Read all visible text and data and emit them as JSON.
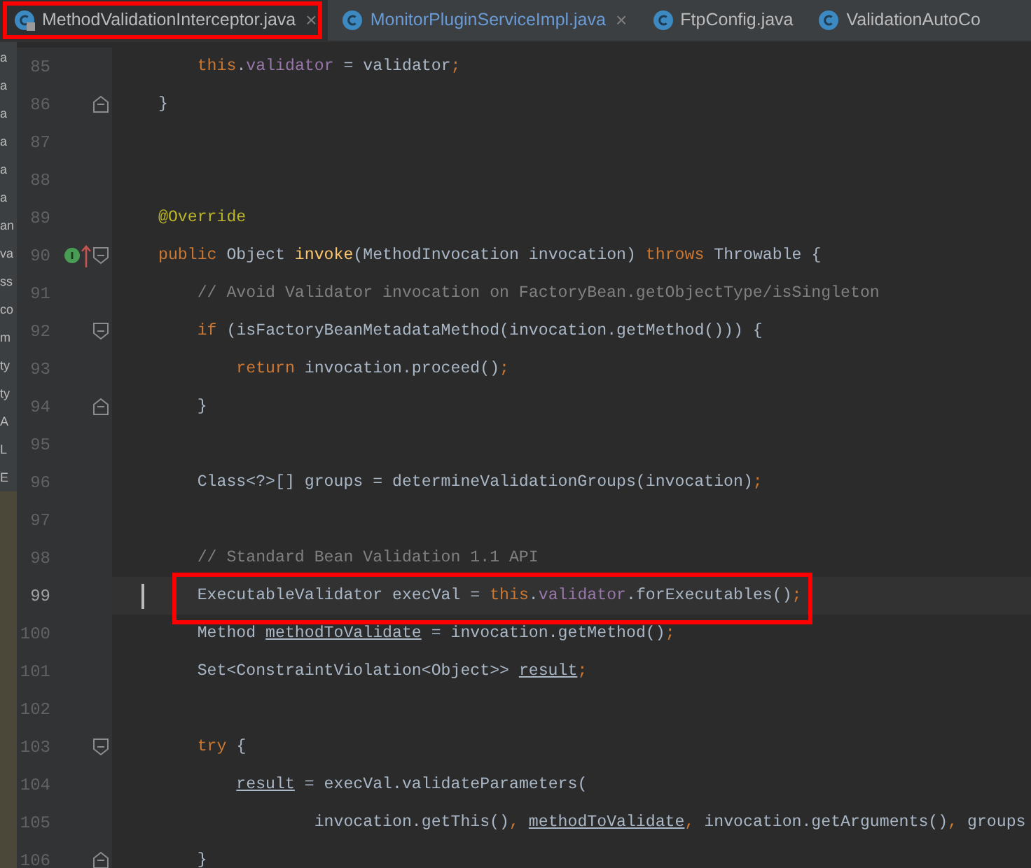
{
  "tabs": [
    {
      "label": "MethodValidationInterceptor.java",
      "selected": true,
      "modified": false,
      "locked": true,
      "close": "×",
      "highlighted": true
    },
    {
      "label": "MonitorPluginServiceImpl.java",
      "selected": false,
      "modified": true,
      "locked": false,
      "close": "×",
      "highlighted": false
    },
    {
      "label": "FtpConfig.java",
      "selected": false,
      "modified": false,
      "locked": false,
      "highlighted": false
    },
    {
      "label": "ValidationAutoCo",
      "selected": false,
      "modified": false,
      "locked": false,
      "highlighted": false
    }
  ],
  "sidebar_fragments": [
    "a",
    "a",
    "a",
    "a",
    "a",
    "a",
    "an",
    "va",
    "ss",
    "co",
    "m",
    "ty",
    "ty",
    "A",
    "L",
    "E"
  ],
  "lines": [
    {
      "number": "85",
      "tokens": [
        {
          "text": "    this",
          "kind": "kw"
        },
        {
          "text": ".",
          "kind": "plain"
        },
        {
          "text": "validator",
          "kind": "field"
        },
        {
          "text": " = validator",
          "kind": "plain"
        },
        {
          "text": ";",
          "kind": "punct"
        }
      ]
    },
    {
      "number": "86",
      "fold_end": true,
      "tokens": [
        {
          "text": "}",
          "kind": "plain"
        }
      ]
    },
    {
      "number": "87"
    },
    {
      "number": "88"
    },
    {
      "number": "89",
      "tokens": [
        {
          "text": "@Override",
          "kind": "annotation"
        }
      ]
    },
    {
      "number": "90",
      "fold_start": true,
      "overrides": true,
      "tokens": [
        {
          "text": "public",
          "kind": "kw"
        },
        {
          "text": " Object ",
          "kind": "plain"
        },
        {
          "text": "invoke",
          "kind": "decl"
        },
        {
          "text": "(MethodInvocation invocation) ",
          "kind": "plain"
        },
        {
          "text": "throws",
          "kind": "kw"
        },
        {
          "text": " Throwable {",
          "kind": "plain"
        }
      ]
    },
    {
      "number": "91",
      "tokens": [
        {
          "text": "    // Avoid Validator invocation on FactoryBean.getObjectType/isSingleton",
          "kind": "comment"
        }
      ]
    },
    {
      "number": "92",
      "fold_start": true,
      "tokens": [
        {
          "text": "    if",
          "kind": "kw"
        },
        {
          "text": " (isFactoryBeanMetadataMethod(invocation.getMethod())) {",
          "kind": "plain"
        }
      ]
    },
    {
      "number": "93",
      "tokens": [
        {
          "text": "        return",
          "kind": "kw"
        },
        {
          "text": " invocation.proceed()",
          "kind": "plain"
        },
        {
          "text": ";",
          "kind": "punct"
        }
      ]
    },
    {
      "number": "94",
      "fold_end": true,
      "tokens": [
        {
          "text": "    }",
          "kind": "plain"
        }
      ]
    },
    {
      "number": "95"
    },
    {
      "number": "96",
      "tokens": [
        {
          "text": "    Class<?>[] groups = determineValidationGroups(invocation)",
          "kind": "plain"
        },
        {
          "text": ";",
          "kind": "punct"
        }
      ]
    },
    {
      "number": "97"
    },
    {
      "number": "98",
      "tokens": [
        {
          "text": "    // Standard Bean Validation 1.1 API",
          "kind": "comment"
        }
      ]
    },
    {
      "number": "99",
      "current": true,
      "highlighted": true,
      "tokens": [
        {
          "text": "    ExecutableValidator execVal = ",
          "kind": "plain"
        },
        {
          "text": "this",
          "kind": "kw"
        },
        {
          "text": ".",
          "kind": "plain"
        },
        {
          "text": "validator",
          "kind": "field"
        },
        {
          "text": ".forExecutables()",
          "kind": "plain"
        },
        {
          "text": ";",
          "kind": "punct"
        }
      ]
    },
    {
      "number": "100",
      "tokens": [
        {
          "text": "    Method ",
          "kind": "plain"
        },
        {
          "text": "methodToValidate",
          "kind": "underline"
        },
        {
          "text": " = invocation.getMethod()",
          "kind": "plain"
        },
        {
          "text": ";",
          "kind": "punct"
        }
      ]
    },
    {
      "number": "101",
      "tokens": [
        {
          "text": "    Set<ConstraintViolation<Object>> ",
          "kind": "plain"
        },
        {
          "text": "result",
          "kind": "underline"
        },
        {
          "text": ";",
          "kind": "punct"
        }
      ]
    },
    {
      "number": "102"
    },
    {
      "number": "103",
      "fold_start": true,
      "tokens": [
        {
          "text": "    try",
          "kind": "kw"
        },
        {
          "text": " {",
          "kind": "plain"
        }
      ]
    },
    {
      "number": "104",
      "tokens": [
        {
          "text": "        result",
          "kind": "underline"
        },
        {
          "text": " = execVal.validateParameters(",
          "kind": "plain"
        }
      ]
    },
    {
      "number": "105",
      "tokens": [
        {
          "text": "                invocation.getThis()",
          "kind": "plain"
        },
        {
          "text": ", ",
          "kind": "punct"
        },
        {
          "text": "methodToValidate",
          "kind": "underline"
        },
        {
          "text": ", ",
          "kind": "punct"
        },
        {
          "text": "invocation.getArguments()",
          "kind": "plain"
        },
        {
          "text": ", ",
          "kind": "punct"
        },
        {
          "text": "groups",
          "kind": "plain"
        }
      ]
    },
    {
      "number": "106",
      "fold_end": true,
      "tokens": [
        {
          "text": "    }",
          "kind": "plain"
        }
      ]
    }
  ]
}
